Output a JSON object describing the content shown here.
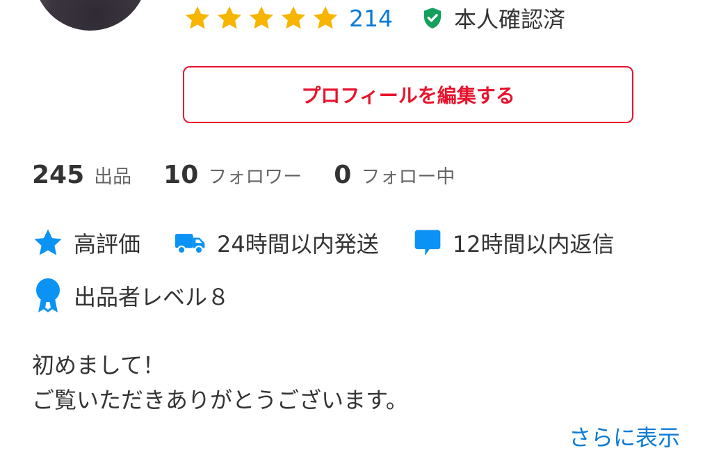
{
  "profile": {
    "avatar_alt": "",
    "rating_stars": 5,
    "rating_count": "214",
    "verified_label": "本人確認済",
    "edit_button_label": "プロフィールを編集する"
  },
  "stats": [
    {
      "number": "245",
      "label": "出品"
    },
    {
      "number": "10",
      "label": "フォロワー"
    },
    {
      "number": "0",
      "label": "フォロー中"
    }
  ],
  "badges": [
    {
      "icon": "star-icon",
      "label": "高評価"
    },
    {
      "icon": "truck-icon",
      "label": "24時間以内発送"
    },
    {
      "icon": "chat-bubble-icon",
      "label": "12時間以内返信"
    },
    {
      "icon": "medal-icon",
      "label": "出品者レベル８"
    }
  ],
  "bio": {
    "line1": "初めまして！",
    "line2": "ご覧いただきありがとうございます。",
    "more_label": "さらに表示"
  },
  "colors": {
    "star": "#f7b500",
    "link": "#0b7bd4",
    "accent_red": "#e8142d",
    "verified_green": "#12a05c",
    "badge_blue": "#0a93f5"
  }
}
